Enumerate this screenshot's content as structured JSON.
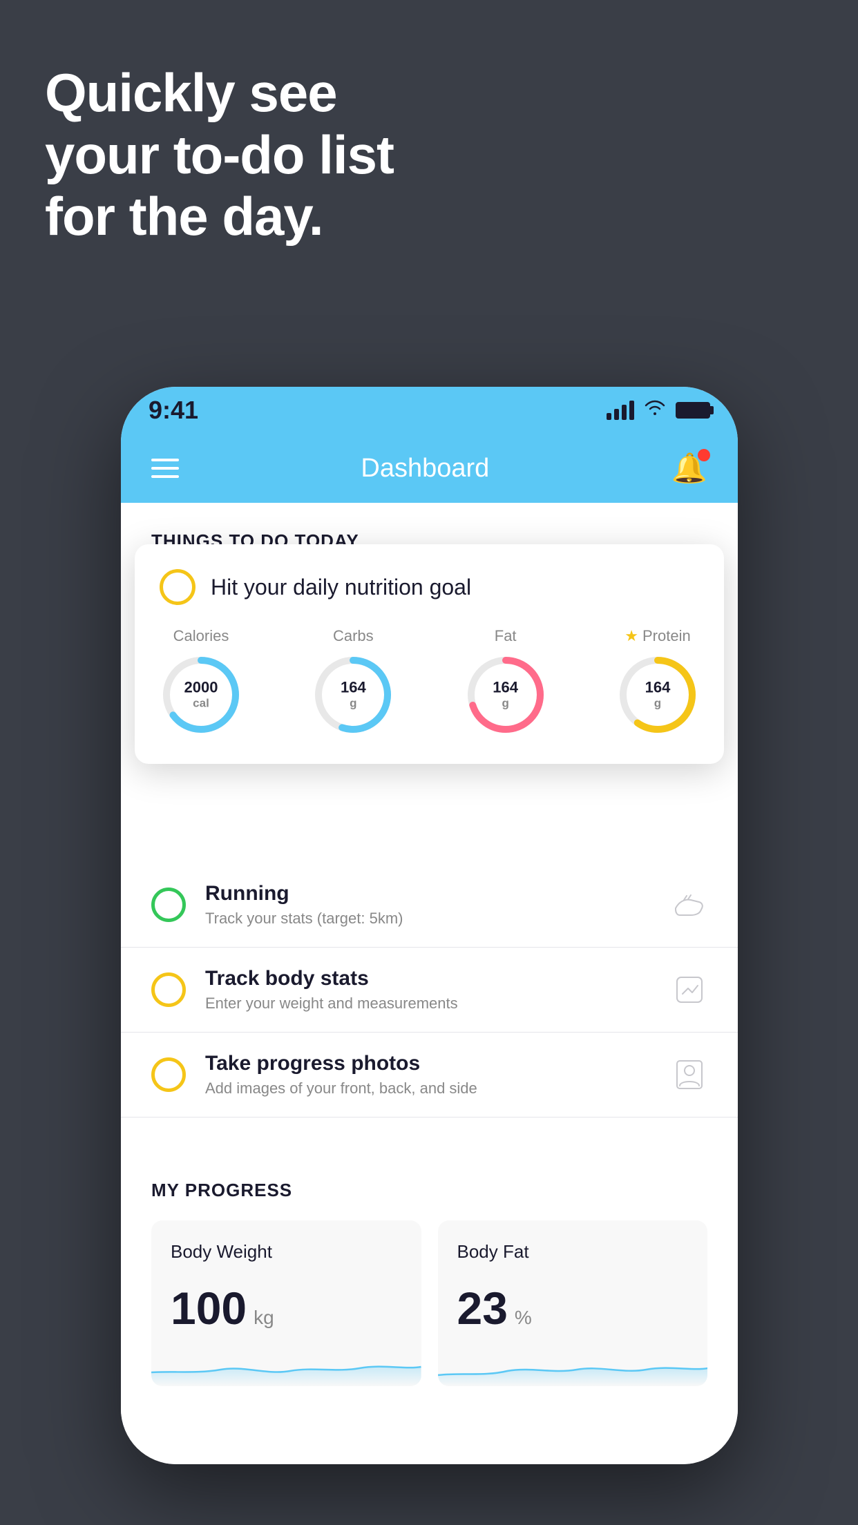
{
  "background": {
    "color": "#3a3e47"
  },
  "headline": {
    "line1": "Quickly see",
    "line2": "your to-do list",
    "line3": "for the day."
  },
  "statusBar": {
    "time": "9:41",
    "signalLabel": "signal",
    "wifiLabel": "wifi",
    "batteryLabel": "battery"
  },
  "header": {
    "title": "Dashboard",
    "menuLabel": "menu",
    "bellLabel": "notifications"
  },
  "thingsToDo": {
    "sectionTitle": "THINGS TO DO TODAY"
  },
  "nutritionCard": {
    "title": "Hit your daily nutrition goal",
    "items": [
      {
        "label": "Calories",
        "value": "2000",
        "unit": "cal",
        "color": "#5bc8f5",
        "percent": 65,
        "starred": false
      },
      {
        "label": "Carbs",
        "value": "164",
        "unit": "g",
        "color": "#5bc8f5",
        "percent": 55,
        "starred": false
      },
      {
        "label": "Fat",
        "value": "164",
        "unit": "g",
        "color": "#ff6b8a",
        "percent": 70,
        "starred": false
      },
      {
        "label": "Protein",
        "value": "164",
        "unit": "g",
        "color": "#f5c518",
        "percent": 60,
        "starred": true
      }
    ]
  },
  "todoItems": [
    {
      "title": "Running",
      "subtitle": "Track your stats (target: 5km)",
      "circleColor": "green",
      "icon": "shoe"
    },
    {
      "title": "Track body stats",
      "subtitle": "Enter your weight and measurements",
      "circleColor": "yellow",
      "icon": "scale"
    },
    {
      "title": "Take progress photos",
      "subtitle": "Add images of your front, back, and side",
      "circleColor": "yellow",
      "icon": "person"
    }
  ],
  "progressSection": {
    "title": "MY PROGRESS",
    "cards": [
      {
        "title": "Body Weight",
        "value": "100",
        "unit": "kg"
      },
      {
        "title": "Body Fat",
        "value": "23",
        "unit": "%"
      }
    ]
  }
}
